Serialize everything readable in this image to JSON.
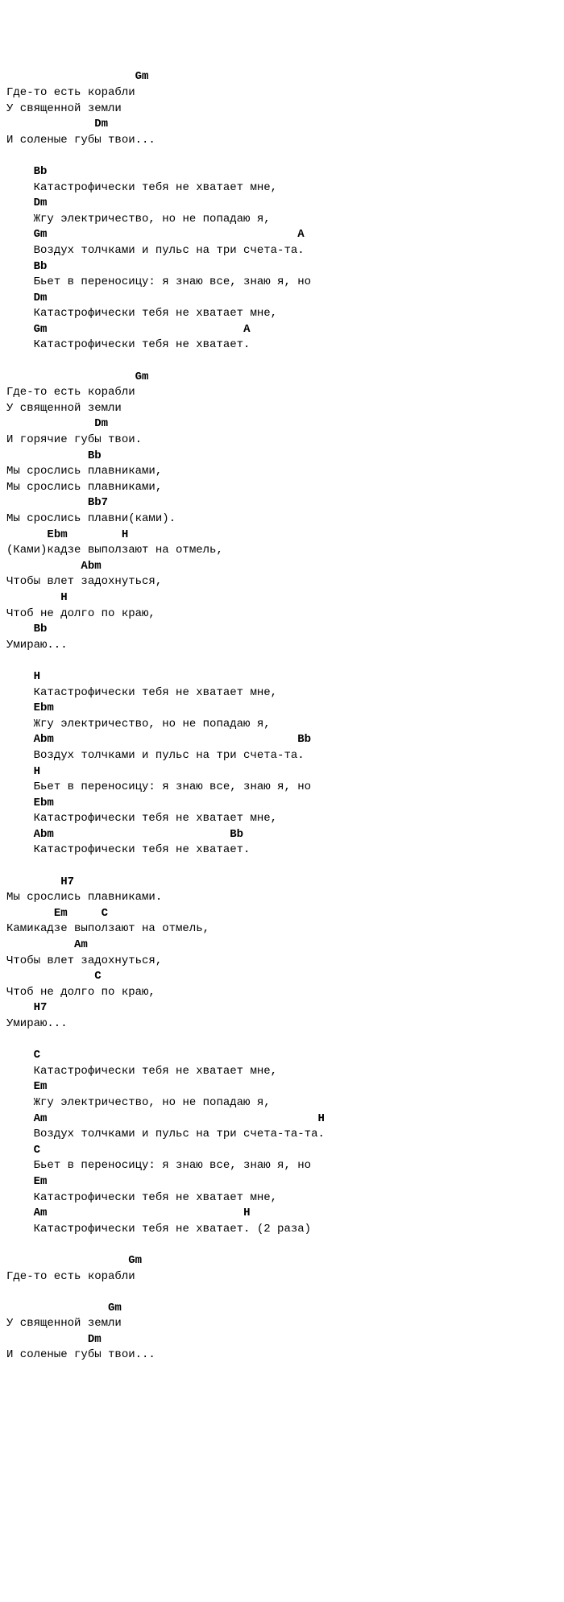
{
  "chart_data": null,
  "lines": [
    {
      "indent": 0,
      "parts": [
        {
          "t": "                   ",
          "c": false
        },
        {
          "t": "Gm",
          "c": true
        }
      ]
    },
    {
      "indent": 0,
      "parts": [
        {
          "t": "Где-то есть корабли",
          "c": false
        }
      ]
    },
    {
      "indent": 0,
      "parts": [
        {
          "t": "У священной земли",
          "c": false
        }
      ]
    },
    {
      "indent": 0,
      "parts": [
        {
          "t": "             ",
          "c": false
        },
        {
          "t": "Dm",
          "c": true
        }
      ]
    },
    {
      "indent": 0,
      "parts": [
        {
          "t": "И соленые губы твои...",
          "c": false
        }
      ]
    },
    {
      "indent": 0,
      "parts": [
        {
          "t": "",
          "c": false
        }
      ]
    },
    {
      "indent": 4,
      "parts": [
        {
          "t": "Bb",
          "c": true
        }
      ]
    },
    {
      "indent": 4,
      "parts": [
        {
          "t": "Катастрофически тебя не хватает мне,",
          "c": false
        }
      ]
    },
    {
      "indent": 4,
      "parts": [
        {
          "t": "Dm",
          "c": true
        }
      ]
    },
    {
      "indent": 4,
      "parts": [
        {
          "t": "Жгу электричество, но не попадаю я,",
          "c": false
        }
      ]
    },
    {
      "indent": 4,
      "parts": [
        {
          "t": "Gm",
          "c": true
        },
        {
          "t": "                                     ",
          "c": false
        },
        {
          "t": "A",
          "c": true
        }
      ]
    },
    {
      "indent": 4,
      "parts": [
        {
          "t": "Воздух толчками и пульс на три счета-та.",
          "c": false
        }
      ]
    },
    {
      "indent": 4,
      "parts": [
        {
          "t": "Bb",
          "c": true
        }
      ]
    },
    {
      "indent": 4,
      "parts": [
        {
          "t": "Бьет в переносицу: я знаю все, знаю я, но",
          "c": false
        }
      ]
    },
    {
      "indent": 4,
      "parts": [
        {
          "t": "Dm",
          "c": true
        }
      ]
    },
    {
      "indent": 4,
      "parts": [
        {
          "t": "Катастрофически тебя не хватает мне,",
          "c": false
        }
      ]
    },
    {
      "indent": 4,
      "parts": [
        {
          "t": "Gm",
          "c": true
        },
        {
          "t": "                             ",
          "c": false
        },
        {
          "t": "A",
          "c": true
        }
      ]
    },
    {
      "indent": 4,
      "parts": [
        {
          "t": "Катастрофически тебя не хватает.",
          "c": false
        }
      ]
    },
    {
      "indent": 0,
      "parts": [
        {
          "t": "",
          "c": false
        }
      ]
    },
    {
      "indent": 0,
      "parts": [
        {
          "t": "                   ",
          "c": false
        },
        {
          "t": "Gm",
          "c": true
        }
      ]
    },
    {
      "indent": 0,
      "parts": [
        {
          "t": "Где-то есть корабли",
          "c": false
        }
      ]
    },
    {
      "indent": 0,
      "parts": [
        {
          "t": "У священной земли",
          "c": false
        }
      ]
    },
    {
      "indent": 0,
      "parts": [
        {
          "t": "             ",
          "c": false
        },
        {
          "t": "Dm",
          "c": true
        }
      ]
    },
    {
      "indent": 0,
      "parts": [
        {
          "t": "И горячие губы твои.",
          "c": false
        }
      ]
    },
    {
      "indent": 0,
      "parts": [
        {
          "t": "            ",
          "c": false
        },
        {
          "t": "Bb",
          "c": true
        }
      ]
    },
    {
      "indent": 0,
      "parts": [
        {
          "t": "Мы срослись плавниками,",
          "c": false
        }
      ]
    },
    {
      "indent": 0,
      "parts": [
        {
          "t": "Мы срослись плавниками,",
          "c": false
        }
      ]
    },
    {
      "indent": 0,
      "parts": [
        {
          "t": "            ",
          "c": false
        },
        {
          "t": "Bb7",
          "c": true
        }
      ]
    },
    {
      "indent": 0,
      "parts": [
        {
          "t": "Мы срослись плавни(ками).",
          "c": false
        }
      ]
    },
    {
      "indent": 0,
      "parts": [
        {
          "t": "      ",
          "c": false
        },
        {
          "t": "Ebm",
          "c": true
        },
        {
          "t": "        ",
          "c": false
        },
        {
          "t": "H",
          "c": true
        }
      ]
    },
    {
      "indent": 0,
      "parts": [
        {
          "t": "(Ками)кадзе выползают на отмель,",
          "c": false
        }
      ]
    },
    {
      "indent": 0,
      "parts": [
        {
          "t": "           ",
          "c": false
        },
        {
          "t": "Abm",
          "c": true
        }
      ]
    },
    {
      "indent": 0,
      "parts": [
        {
          "t": "Чтобы влет задохнуться,",
          "c": false
        }
      ]
    },
    {
      "indent": 0,
      "parts": [
        {
          "t": "        ",
          "c": false
        },
        {
          "t": "H",
          "c": true
        }
      ]
    },
    {
      "indent": 0,
      "parts": [
        {
          "t": "Чтоб не долго по краю,",
          "c": false
        }
      ]
    },
    {
      "indent": 0,
      "parts": [
        {
          "t": "    ",
          "c": false
        },
        {
          "t": "Bb",
          "c": true
        }
      ]
    },
    {
      "indent": 0,
      "parts": [
        {
          "t": "Умираю...",
          "c": false
        }
      ]
    },
    {
      "indent": 0,
      "parts": [
        {
          "t": "",
          "c": false
        }
      ]
    },
    {
      "indent": 4,
      "parts": [
        {
          "t": "H",
          "c": true
        }
      ]
    },
    {
      "indent": 4,
      "parts": [
        {
          "t": "Катастрофически тебя не хватает мне,",
          "c": false
        }
      ]
    },
    {
      "indent": 4,
      "parts": [
        {
          "t": "Ebm",
          "c": true
        }
      ]
    },
    {
      "indent": 4,
      "parts": [
        {
          "t": "Жгу электричество, но не попадаю я,",
          "c": false
        }
      ]
    },
    {
      "indent": 4,
      "parts": [
        {
          "t": "Abm",
          "c": true
        },
        {
          "t": "                                    ",
          "c": false
        },
        {
          "t": "Bb",
          "c": true
        }
      ]
    },
    {
      "indent": 4,
      "parts": [
        {
          "t": "Воздух толчками и пульс на три счета-та.",
          "c": false
        }
      ]
    },
    {
      "indent": 4,
      "parts": [
        {
          "t": "H",
          "c": true
        }
      ]
    },
    {
      "indent": 4,
      "parts": [
        {
          "t": "Бьет в переносицу: я знаю все, знаю я, но",
          "c": false
        }
      ]
    },
    {
      "indent": 4,
      "parts": [
        {
          "t": "Ebm",
          "c": true
        }
      ]
    },
    {
      "indent": 4,
      "parts": [
        {
          "t": "Катастрофически тебя не хватает мне,",
          "c": false
        }
      ]
    },
    {
      "indent": 4,
      "parts": [
        {
          "t": "Abm",
          "c": true
        },
        {
          "t": "                          ",
          "c": false
        },
        {
          "t": "Bb",
          "c": true
        }
      ]
    },
    {
      "indent": 4,
      "parts": [
        {
          "t": "Катастрофически тебя не хватает.",
          "c": false
        }
      ]
    },
    {
      "indent": 0,
      "parts": [
        {
          "t": "",
          "c": false
        }
      ]
    },
    {
      "indent": 0,
      "parts": [
        {
          "t": "        ",
          "c": false
        },
        {
          "t": "H7",
          "c": true
        }
      ]
    },
    {
      "indent": 0,
      "parts": [
        {
          "t": "Мы срослись плавниками.",
          "c": false
        }
      ]
    },
    {
      "indent": 0,
      "parts": [
        {
          "t": "       ",
          "c": false
        },
        {
          "t": "Em",
          "c": true
        },
        {
          "t": "     ",
          "c": false
        },
        {
          "t": "C",
          "c": true
        }
      ]
    },
    {
      "indent": 0,
      "parts": [
        {
          "t": "Камикадзе выползают на отмель,",
          "c": false
        }
      ]
    },
    {
      "indent": 0,
      "parts": [
        {
          "t": "          ",
          "c": false
        },
        {
          "t": "Am",
          "c": true
        }
      ]
    },
    {
      "indent": 0,
      "parts": [
        {
          "t": "Чтобы влет задохнуться,",
          "c": false
        }
      ]
    },
    {
      "indent": 0,
      "parts": [
        {
          "t": "             ",
          "c": false
        },
        {
          "t": "C",
          "c": true
        }
      ]
    },
    {
      "indent": 0,
      "parts": [
        {
          "t": "Чтоб не долго по краю,",
          "c": false
        }
      ]
    },
    {
      "indent": 0,
      "parts": [
        {
          "t": "    ",
          "c": false
        },
        {
          "t": "H7",
          "c": true
        }
      ]
    },
    {
      "indent": 0,
      "parts": [
        {
          "t": "Умираю...",
          "c": false
        }
      ]
    },
    {
      "indent": 0,
      "parts": [
        {
          "t": "",
          "c": false
        }
      ]
    },
    {
      "indent": 4,
      "parts": [
        {
          "t": "C",
          "c": true
        }
      ]
    },
    {
      "indent": 4,
      "parts": [
        {
          "t": "Катастрофически тебя не хватает мне,",
          "c": false
        }
      ]
    },
    {
      "indent": 4,
      "parts": [
        {
          "t": "Em",
          "c": true
        }
      ]
    },
    {
      "indent": 4,
      "parts": [
        {
          "t": "Жгу электричество, но не попадаю я,",
          "c": false
        }
      ]
    },
    {
      "indent": 4,
      "parts": [
        {
          "t": "Am",
          "c": true
        },
        {
          "t": "                                        ",
          "c": false
        },
        {
          "t": "H",
          "c": true
        }
      ]
    },
    {
      "indent": 4,
      "parts": [
        {
          "t": "Воздух толчками и пульс на три счета-та-та.",
          "c": false
        }
      ]
    },
    {
      "indent": 4,
      "parts": [
        {
          "t": "C",
          "c": true
        }
      ]
    },
    {
      "indent": 4,
      "parts": [
        {
          "t": "Бьет в переносицу: я знаю все, знаю я, но",
          "c": false
        }
      ]
    },
    {
      "indent": 4,
      "parts": [
        {
          "t": "Em",
          "c": true
        }
      ]
    },
    {
      "indent": 4,
      "parts": [
        {
          "t": "Катастрофически тебя не хватает мне,",
          "c": false
        }
      ]
    },
    {
      "indent": 4,
      "parts": [
        {
          "t": "Am",
          "c": true
        },
        {
          "t": "                             ",
          "c": false
        },
        {
          "t": "H",
          "c": true
        }
      ]
    },
    {
      "indent": 4,
      "parts": [
        {
          "t": "Катастрофически тебя не хватает. (2 раза)",
          "c": false
        }
      ]
    },
    {
      "indent": 0,
      "parts": [
        {
          "t": "",
          "c": false
        }
      ]
    },
    {
      "indent": 0,
      "parts": [
        {
          "t": "                  ",
          "c": false
        },
        {
          "t": "Gm",
          "c": true
        }
      ]
    },
    {
      "indent": 0,
      "parts": [
        {
          "t": "Где-то есть корабли",
          "c": false
        }
      ]
    },
    {
      "indent": 0,
      "parts": [
        {
          "t": "",
          "c": false
        }
      ]
    },
    {
      "indent": 0,
      "parts": [
        {
          "t": "               ",
          "c": false
        },
        {
          "t": "Gm",
          "c": true
        }
      ]
    },
    {
      "indent": 0,
      "parts": [
        {
          "t": "У священной земли",
          "c": false
        }
      ]
    },
    {
      "indent": 0,
      "parts": [
        {
          "t": "            ",
          "c": false
        },
        {
          "t": "Dm",
          "c": true
        }
      ]
    },
    {
      "indent": 0,
      "parts": [
        {
          "t": "И соленые губы твои...",
          "c": false
        }
      ]
    }
  ]
}
